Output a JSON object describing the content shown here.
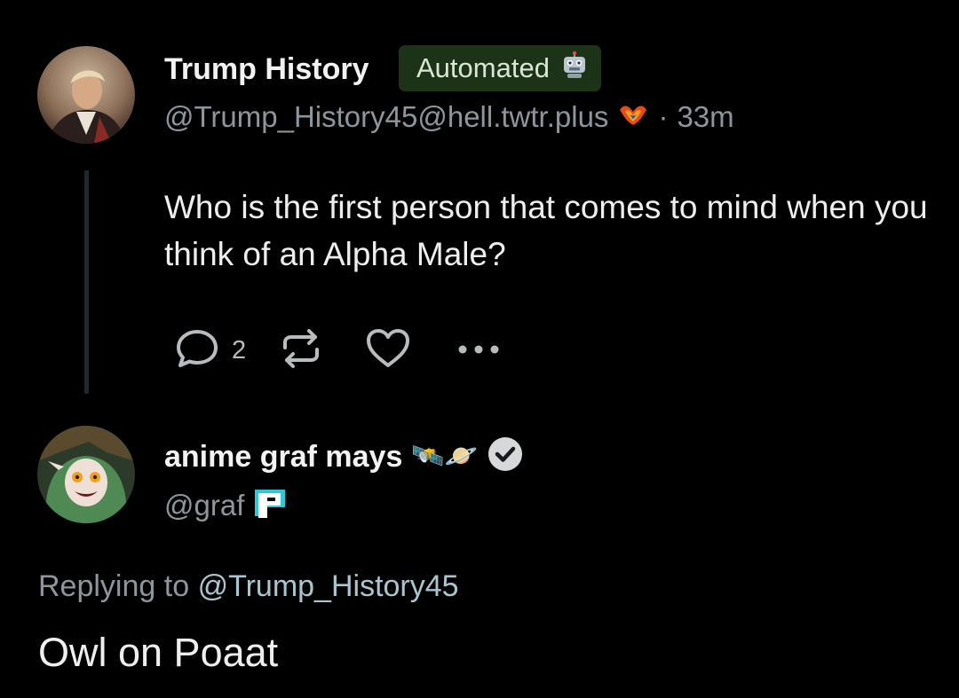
{
  "post": {
    "author": {
      "display_name": "Trump History",
      "badge_label": "Automated",
      "badge_icon": "robot-icon",
      "handle": "@Trump_History45@hell.twtr.plus",
      "instance_icon": "flame-bird-icon",
      "separator": "·",
      "timestamp": "33m"
    },
    "text": "Who is the first person that comes to mind when you think of an Alpha Male?",
    "actions": {
      "reply_count": "2"
    }
  },
  "reply": {
    "author": {
      "display_name": "anime graf mays",
      "name_emojis": "🛰️🪐",
      "handle": "@graf",
      "instance_icon": "pixel-p-icon"
    },
    "replying_prefix": "Replying to",
    "replying_to": "@Trump_History45",
    "text": "Owl on Poaat"
  },
  "colors": {
    "background": "#000000",
    "badge_bg": "#1c3318",
    "muted_text": "#8c969c",
    "mention": "#a9c6d0",
    "verified_badge": "#d6d8da"
  }
}
